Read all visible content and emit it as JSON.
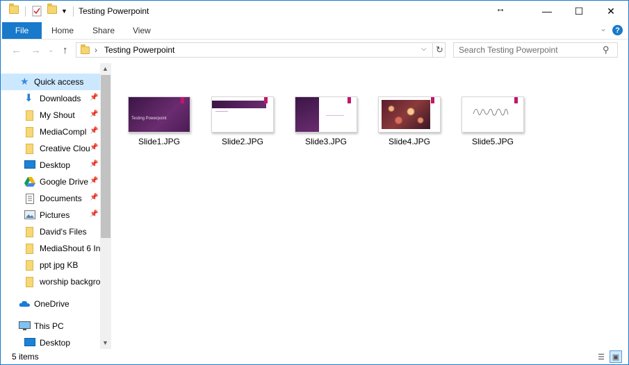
{
  "window": {
    "title": "Testing Powerpoint",
    "minimize": "—",
    "maximize": "☐",
    "close": "✕"
  },
  "ribbon": {
    "tabs": [
      "File",
      "Home",
      "Share",
      "View"
    ],
    "help": "?"
  },
  "address": {
    "path": "Testing Powerpoint"
  },
  "search": {
    "placeholder": "Search Testing Powerpoint"
  },
  "nav": {
    "items": [
      {
        "label": "Quick access",
        "icon": "star-icon",
        "pinned": false,
        "selected": true
      },
      {
        "label": "Downloads",
        "icon": "download-arrow-icon",
        "pinned": true
      },
      {
        "label": "My Shout",
        "icon": "folder-icon",
        "pinned": true
      },
      {
        "label": "MediaCompl",
        "icon": "folder-icon",
        "pinned": true
      },
      {
        "label": "Creative Clou",
        "icon": "folder-icon",
        "pinned": true
      },
      {
        "label": "Desktop",
        "icon": "desktop-icon",
        "pinned": true
      },
      {
        "label": "Google Drive",
        "icon": "google-drive-icon",
        "pinned": true
      },
      {
        "label": "Documents",
        "icon": "document-icon",
        "pinned": true
      },
      {
        "label": "Pictures",
        "icon": "pictures-icon",
        "pinned": true
      },
      {
        "label": "David's Files",
        "icon": "folder-icon",
        "pinned": false
      },
      {
        "label": "MediaShout 6 In",
        "icon": "folder-icon",
        "pinned": false
      },
      {
        "label": "ppt jpg KB",
        "icon": "folder-icon",
        "pinned": false
      },
      {
        "label": "worship backgro",
        "icon": "folder-icon",
        "pinned": false
      },
      {
        "label": "OneDrive",
        "icon": "onedrive-cloud-icon",
        "pinned": false
      },
      {
        "label": "This PC",
        "icon": "computer-icon",
        "pinned": false
      },
      {
        "label": "Desktop",
        "icon": "desktop-icon",
        "pinned": false
      }
    ]
  },
  "files": [
    {
      "name": "Slide1.JPG",
      "thumb_text": "Testing Powerpoint"
    },
    {
      "name": "Slide2.JPG",
      "thumb_text": ""
    },
    {
      "name": "Slide3.JPG",
      "thumb_text": ""
    },
    {
      "name": "Slide4.JPG",
      "thumb_text": ""
    },
    {
      "name": "Slide5.JPG",
      "thumb_text": ""
    }
  ],
  "status": {
    "count": "5 items"
  },
  "colors": {
    "accent": "#1979ca",
    "selection": "#cce8ff",
    "slide_purple": "#4b1d52",
    "slide_tag": "#c0176b"
  }
}
